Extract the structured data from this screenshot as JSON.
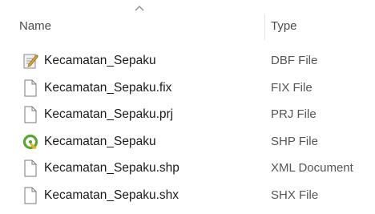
{
  "columns": {
    "name": "Name",
    "type": "Type"
  },
  "files": [
    {
      "name": "Kecamatan_Sepaku",
      "type": "DBF File",
      "icon": "dbf-file-icon"
    },
    {
      "name": "Kecamatan_Sepaku.fix",
      "type": "FIX File",
      "icon": "blank-file-icon"
    },
    {
      "name": "Kecamatan_Sepaku.prj",
      "type": "PRJ File",
      "icon": "blank-file-icon"
    },
    {
      "name": "Kecamatan_Sepaku",
      "type": "SHP File",
      "icon": "qgis-icon"
    },
    {
      "name": "Kecamatan_Sepaku.shp",
      "type": "XML Document",
      "icon": "blank-file-icon"
    },
    {
      "name": "Kecamatan_Sepaku.shx",
      "type": "SHX File",
      "icon": "blank-file-icon"
    }
  ]
}
